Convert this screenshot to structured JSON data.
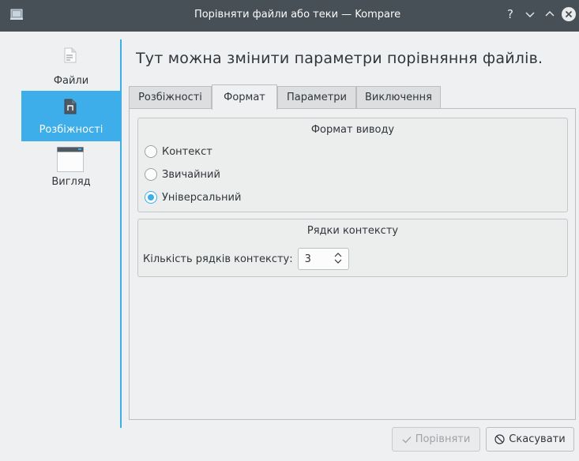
{
  "window": {
    "title": "Порівняти файли або теки — Kompare",
    "controls": {
      "help": "?",
      "minimize": "⌄",
      "maximize": "⌃",
      "close": "✕"
    }
  },
  "sidebar": {
    "items": [
      {
        "label": "Файли",
        "icon": "file-icon",
        "active": false
      },
      {
        "label": "Розбіжності",
        "icon": "diff-icon",
        "active": true
      },
      {
        "label": "Вигляд",
        "icon": "window-icon",
        "active": false
      }
    ]
  },
  "page": {
    "heading": "Тут можна змінити параметри порівняння файлів."
  },
  "tabs": [
    {
      "label": "Розбіжності",
      "active": false
    },
    {
      "label": "Формат",
      "active": true
    },
    {
      "label": "Параметри",
      "active": false
    },
    {
      "label": "Виключення",
      "active": false
    }
  ],
  "output_format": {
    "title": "Формат виводу",
    "options": [
      {
        "label": "Контекст",
        "checked": false
      },
      {
        "label": "Звичайний",
        "checked": false
      },
      {
        "label": "Універсальний",
        "checked": true
      }
    ]
  },
  "context_lines": {
    "title": "Рядки контексту",
    "label": "Кількість рядків контексту:",
    "value": "3"
  },
  "buttons": {
    "compare": {
      "label": "Порівняти",
      "icon": "check-icon",
      "enabled": false
    },
    "cancel": {
      "label": "Скасувати",
      "icon": "cancel-icon",
      "enabled": true
    }
  },
  "colors": {
    "accent": "#3daee9",
    "titlebar": "#475057",
    "background": "#eff0f1"
  }
}
